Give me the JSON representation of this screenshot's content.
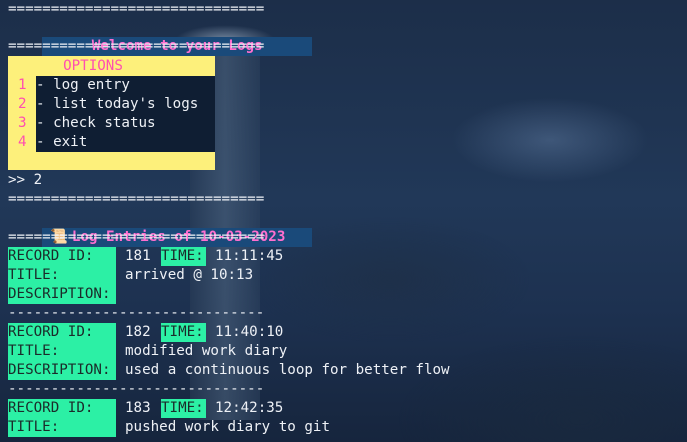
{
  "rule_double": "==============================",
  "rule_single": "------------------------------",
  "banner": "Welcome to your Logs",
  "menu": {
    "heading": "OPTIONS",
    "items": [
      {
        "num": "1",
        "label": "- log entry"
      },
      {
        "num": "2",
        "label": "- list today's logs"
      },
      {
        "num": "3",
        "label": "- check status"
      },
      {
        "num": "4",
        "label": "- exit"
      }
    ]
  },
  "prompt": ">> 2",
  "section": {
    "icon": "scroll-icon",
    "title": "Log Entries of 10-03-2023"
  },
  "labels": {
    "record_id": "RECORD ID:",
    "time": "TIME:",
    "title": "TITLE:",
    "description": "DESCRIPTION:"
  },
  "records": [
    {
      "id": "181",
      "time": "11:11:45",
      "title": "arrived @ 10:13",
      "description": ""
    },
    {
      "id": "182",
      "time": "11:40:10",
      "title": "modified work diary",
      "description": "used a continuous loop for better flow"
    },
    {
      "id": "183",
      "time": "12:42:35",
      "title": "pushed work diary to git"
    }
  ],
  "colors": {
    "banner_bg": "#1a4a7a",
    "banner_text": "#ff6fcf",
    "menu_bg": "#fdf07b",
    "label_bg": "#2cf0a5"
  }
}
